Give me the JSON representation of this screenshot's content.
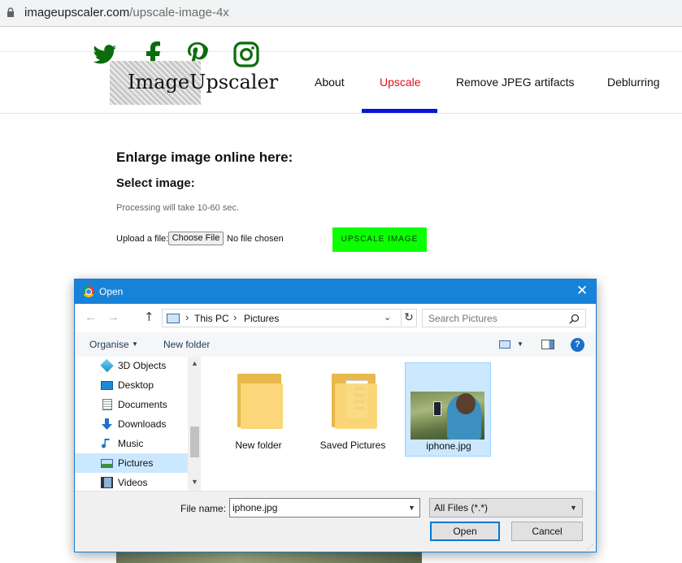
{
  "browser": {
    "url_domain": "imageupscaler.com",
    "url_path": "/upscale-image-4x"
  },
  "site": {
    "logo_text": "ImageUpscaler",
    "nav": [
      {
        "label": "About"
      },
      {
        "label": "Upscale"
      },
      {
        "label": "Remove JPEG artifacts"
      },
      {
        "label": "Deblurring"
      }
    ],
    "social_icons": [
      "twitter-icon",
      "facebook-icon",
      "pinterest-icon",
      "instagram-icon"
    ],
    "colors": {
      "active_nav": "#e0101a",
      "nav_underline": "#0a14d8",
      "social": "#0c6b0c",
      "upscale_button": "#0cff00"
    }
  },
  "content": {
    "heading": "Enlarge image online here:",
    "select_heading": "Select image:",
    "processing_note": "Processing will take 10-60 sec.",
    "upload_label": "Upload a file:",
    "choose_button": "Choose File",
    "no_file": "No file chosen",
    "upscale_button": "UPSCALE IMAGE"
  },
  "dialog": {
    "title": "Open",
    "close_glyph": "✕",
    "breadcrumb": [
      "This PC",
      "Pictures"
    ],
    "search_placeholder": "Search Pictures",
    "toolbar": {
      "organise": "Organise",
      "new_folder": "New folder",
      "help": "?"
    },
    "nav_items": [
      {
        "label": "3D Objects",
        "icon": "3d-objects-icon",
        "selected": false
      },
      {
        "label": "Desktop",
        "icon": "desktop-icon",
        "selected": false
      },
      {
        "label": "Documents",
        "icon": "documents-icon",
        "selected": false
      },
      {
        "label": "Downloads",
        "icon": "downloads-icon",
        "selected": false
      },
      {
        "label": "Music",
        "icon": "music-icon",
        "selected": false
      },
      {
        "label": "Pictures",
        "icon": "pictures-icon",
        "selected": true
      },
      {
        "label": "Videos",
        "icon": "videos-icon",
        "selected": false
      }
    ],
    "files": [
      {
        "label": "New folder",
        "type": "folder",
        "selected": false
      },
      {
        "label": "Saved Pictures",
        "type": "folder",
        "selected": false
      },
      {
        "label": "iphone.jpg",
        "type": "image",
        "selected": true
      }
    ],
    "file_name_label": "File name:",
    "file_name_value": "iphone.jpg",
    "file_type_filter": "All Files (*.*)",
    "open_button": "Open",
    "cancel_button": "Cancel",
    "colors": {
      "titlebar": "#1783d8",
      "selection": "#cce8ff"
    }
  }
}
